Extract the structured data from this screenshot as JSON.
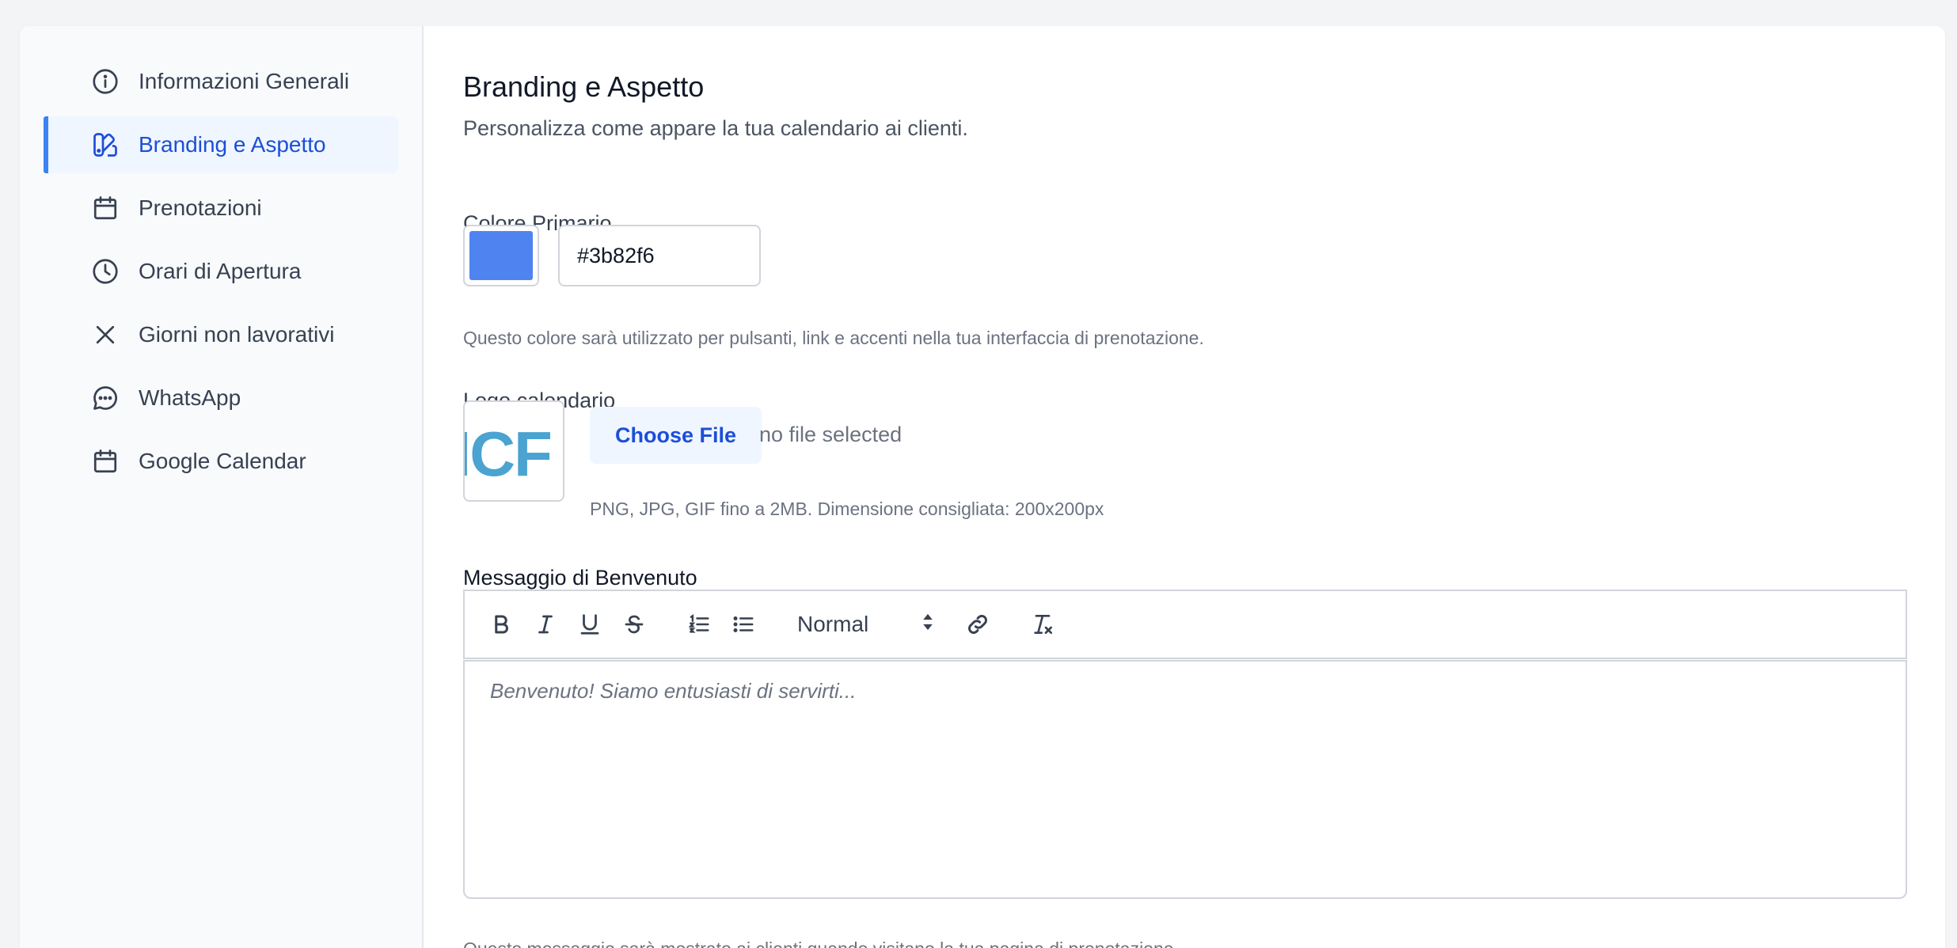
{
  "sidebar": {
    "items": [
      {
        "label": "Informazioni Generali",
        "icon": "info-icon"
      },
      {
        "label": "Branding e Aspetto",
        "icon": "palette-icon",
        "active": true
      },
      {
        "label": "Prenotazioni",
        "icon": "calendar-icon"
      },
      {
        "label": "Orari di Apertura",
        "icon": "clock-icon"
      },
      {
        "label": "Giorni non lavorativi",
        "icon": "close-icon"
      },
      {
        "label": "WhatsApp",
        "icon": "chat-bubble-icon"
      },
      {
        "label": "Google Calendar",
        "icon": "calendar-icon"
      }
    ]
  },
  "main": {
    "title": "Branding e Aspetto",
    "subtitle": "Personalizza come appare la tua calendario ai clienti.",
    "primary_color": {
      "label": "Colore Primario",
      "value": "#3b82f6",
      "help": "Questo colore sarà utilizzato per pulsanti, link e accenti nella tua interfaccia di prenotazione."
    },
    "logo": {
      "label": "Logo calendario",
      "preview_text": "ICF",
      "choose_button": "Choose File",
      "file_status": "no file selected",
      "help": "PNG, JPG, GIF fino a 2MB. Dimensione consigliata: 200x200px"
    },
    "welcome": {
      "label": "Messaggio di Benvenuto",
      "format_select": "Normal",
      "placeholder": "Benvenuto! Siamo entusiasti di servirti...",
      "help": "Questo messaggio sarà mostrato ai clienti quando visitano la tua pagina di prenotazione."
    }
  },
  "colors": {
    "accent": "#3b82f6",
    "active_text": "#1d4ed8",
    "active_bg": "#eff6ff",
    "logo_blue": "#4aa3d1"
  }
}
